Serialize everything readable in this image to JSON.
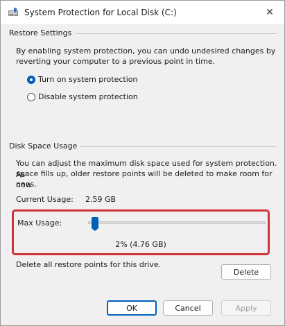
{
  "window": {
    "title": "System Protection for Local Disk (C:)",
    "close_glyph": "✕"
  },
  "restore_settings": {
    "group_title": "Restore Settings",
    "description_line1": "By enabling system protection, you can undo undesired changes by",
    "description_line2": "reverting your computer to a previous point in time.",
    "options": [
      {
        "label": "Turn on system protection",
        "selected": true
      },
      {
        "label": "Disable system protection",
        "selected": false
      }
    ]
  },
  "disk_space": {
    "group_title": "Disk Space Usage",
    "description_line1": "You can adjust the maximum disk space used for system protection. As",
    "description_line2": "space fills up, older restore points will be deleted to make room for new",
    "description_line3": "ones.",
    "current_usage_label": "Current Usage:",
    "current_usage_value": "2.59 GB",
    "max_usage_label": "Max Usage:",
    "max_usage_percent": 2,
    "max_usage_value": "2% (4.76 GB)",
    "delete_text": "Delete all restore points for this drive.",
    "delete_button": "Delete"
  },
  "footer": {
    "ok": "OK",
    "cancel": "Cancel",
    "apply": "Apply"
  },
  "colors": {
    "accent": "#005fb8",
    "highlight": "#d13438"
  },
  "icons": {
    "title_icon": "drive-shield-icon",
    "close_icon": "close-icon"
  }
}
